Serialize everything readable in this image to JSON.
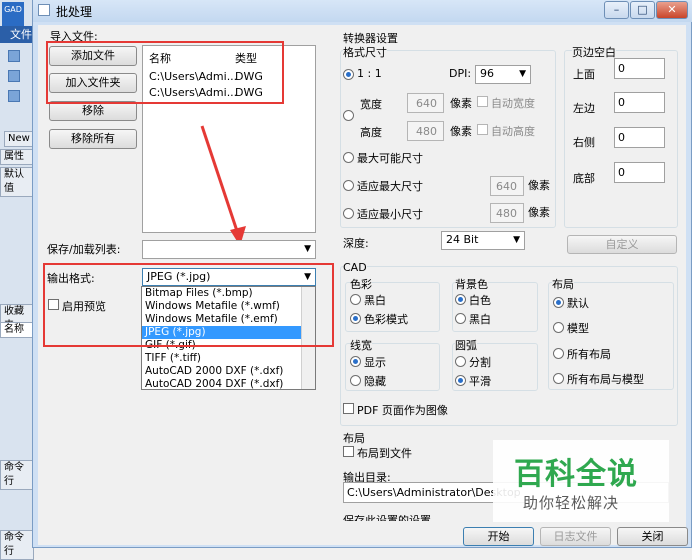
{
  "background_app": {
    "logo_text": "GAD",
    "file_tab": "文件",
    "side_tabs": [
      "New",
      "属性",
      "默认值"
    ],
    "panel_labels": [
      "收藏夹",
      "名称"
    ],
    "command_labels": [
      "命令行",
      "命令行"
    ]
  },
  "window": {
    "title": "批处理",
    "min": "–",
    "max": "□",
    "close": "✕"
  },
  "import": {
    "section": "导入文件:",
    "add_file": "添加文件",
    "add_folder": "加入文件夹",
    "remove": "移除",
    "remove_all": "移除所有",
    "columns": [
      "名称",
      "类型"
    ],
    "rows": [
      {
        "name": "C:\\Users\\Admi...",
        "type": "DWG"
      },
      {
        "name": "C:\\Users\\Admi...",
        "type": "DWG"
      }
    ]
  },
  "save_list": {
    "label": "保存/加载列表:",
    "value": ""
  },
  "output_format": {
    "label": "输出格式:",
    "value": "JPEG (*.jpg)",
    "options": [
      "Bitmap Files (*.bmp)",
      "Windows Metafile (*.wmf)",
      "Windows Metafile (*.emf)",
      "JPEG (*.jpg)",
      "GIF (*.gif)",
      "TIFF (*.tiff)",
      "AutoCAD 2000 DXF (*.dxf)",
      "AutoCAD 2004 DXF (*.dxf)"
    ],
    "selected_index": 3
  },
  "preview": {
    "label": "启用预览"
  },
  "converter": {
    "section": "转换器设置",
    "format_size": "格式尺寸",
    "ratio": "1 : 1",
    "dpi_label": "DPI:",
    "dpi_value": "96",
    "width_label": "宽度",
    "width_value": "640",
    "height_label": "高度",
    "height_value": "480",
    "px_unit": "像素",
    "auto_width": "自动宽度",
    "auto_height": "自动高度",
    "max_possible": "最大可能尺寸",
    "fit_max": "适应最大尺寸",
    "fit_max_value": "640",
    "fit_min": "适应最小尺寸",
    "fit_min_value": "480",
    "depth_label": "深度:",
    "depth_value": "24 Bit"
  },
  "margins": {
    "section": "页边空白",
    "top_label": "上面",
    "top_value": "0",
    "left_label": "左边",
    "left_value": "0",
    "right_label": "右侧",
    "right_value": "0",
    "bottom_label": "底部",
    "bottom_value": "0",
    "custom": "自定义"
  },
  "cad": {
    "section": "CAD",
    "color_label": "色彩",
    "color_options": [
      "黑白",
      "色彩模式"
    ],
    "bg_label": "背景色",
    "bg_options": [
      "白色",
      "黑白"
    ],
    "layout_label": "布局",
    "layout_options": [
      "默认",
      "模型",
      "所有布局",
      "所有布局与模型"
    ],
    "line_label": "线宽",
    "line_options": [
      "显示",
      "隐藏"
    ],
    "arc_label": "圆弧",
    "arc_options": [
      "分割",
      "平滑"
    ],
    "pdf_as_image": "PDF 页面作为图像"
  },
  "layout_section": {
    "label": "布局",
    "to_file": "布局到文件"
  },
  "output_dir": {
    "label": "输出目录:",
    "value": "C:\\Users\\Administrator\\Desktop"
  },
  "bottom_cut_label": "保存此设置的设置",
  "buttons": {
    "start": "开始",
    "log": "日志文件",
    "close": "关闭"
  },
  "watermark": {
    "title": "百科全说",
    "subtitle": "助你轻松解决"
  },
  "colors": {
    "annotation": "#e53935",
    "selection": "#3399ff",
    "watermark": "#2fa84f"
  }
}
